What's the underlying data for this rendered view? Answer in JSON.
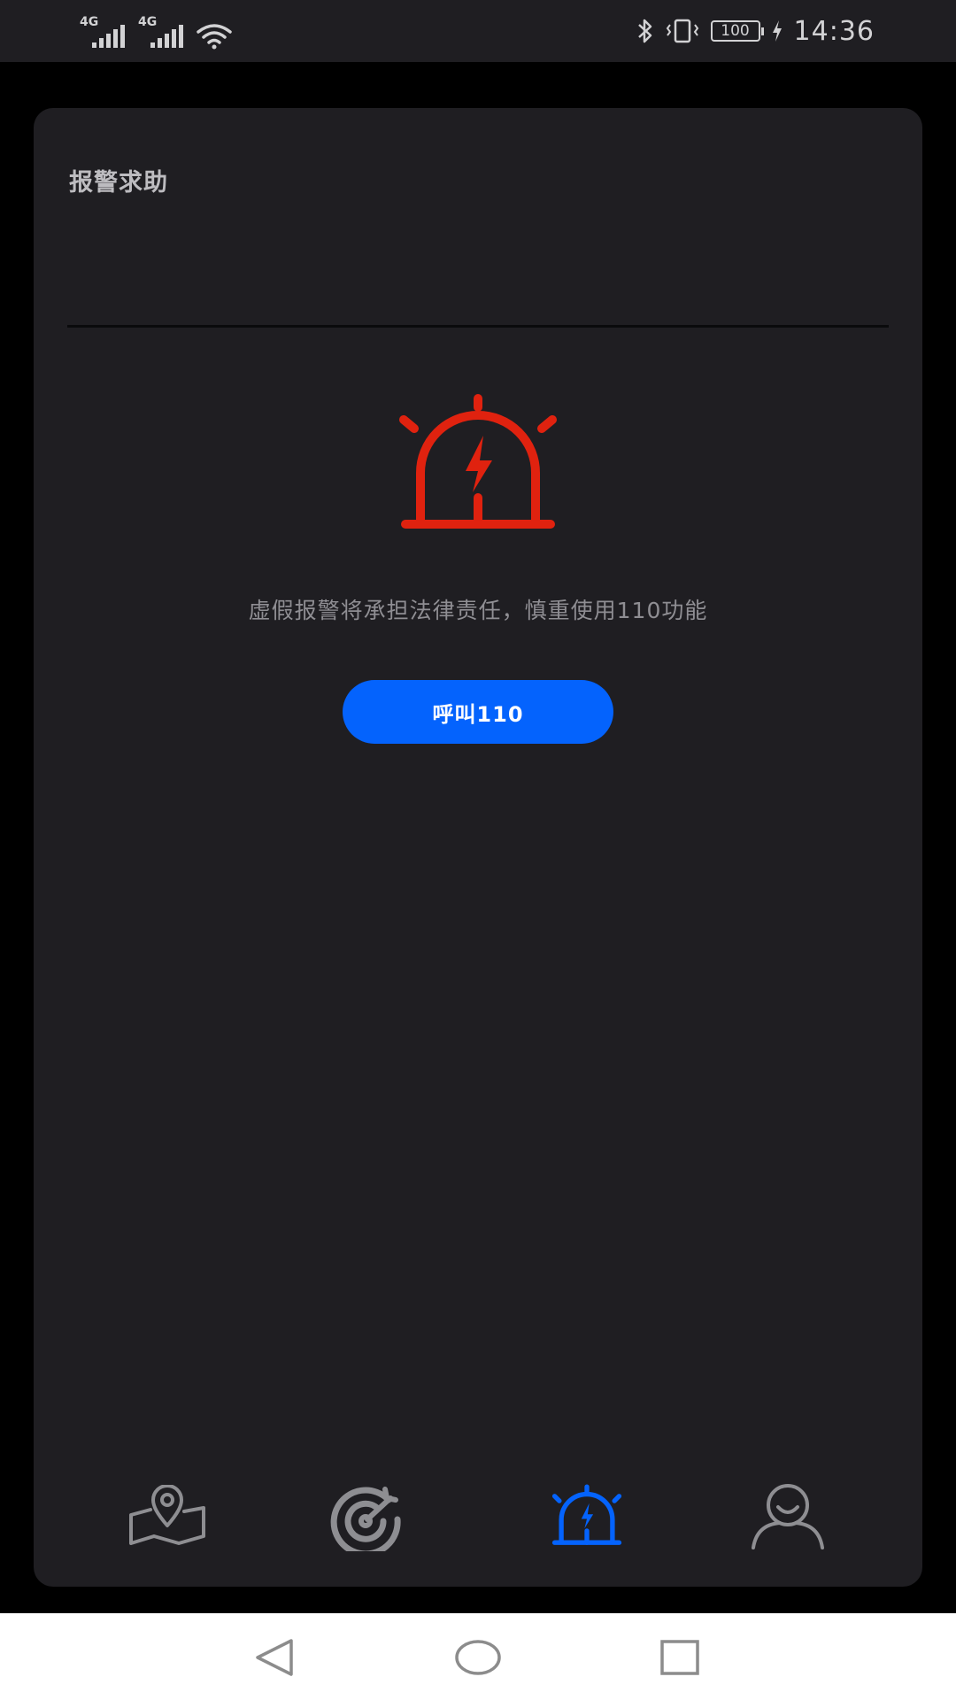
{
  "status_bar": {
    "network_1": "4G",
    "network_2": "4G",
    "battery": "100",
    "time": "14:36",
    "icons": [
      "signal-icon",
      "signal-icon",
      "wifi-icon",
      "bluetooth-icon",
      "vibrate-icon",
      "battery-icon",
      "charging-icon"
    ]
  },
  "page": {
    "title": "报警求助",
    "warning": "虚假报警将承担法律责任，慎重使用110功能",
    "call_button_label": "呼叫110",
    "alarm_icon": "alarm-siren-icon"
  },
  "colors": {
    "background": "#000000",
    "card": "#1f1e22",
    "accent_blue": "#0463fd",
    "alarm_red": "#e0220f",
    "nav_inactive": "#8e8e92"
  },
  "bottom_nav": {
    "items": [
      {
        "icon": "map-pin-icon",
        "active": false
      },
      {
        "icon": "target-icon",
        "active": false
      },
      {
        "icon": "alarm-siren-icon",
        "active": true
      },
      {
        "icon": "user-icon",
        "active": false
      }
    ]
  },
  "system_nav": {
    "items": [
      "back-icon",
      "home-icon",
      "recents-icon"
    ]
  }
}
